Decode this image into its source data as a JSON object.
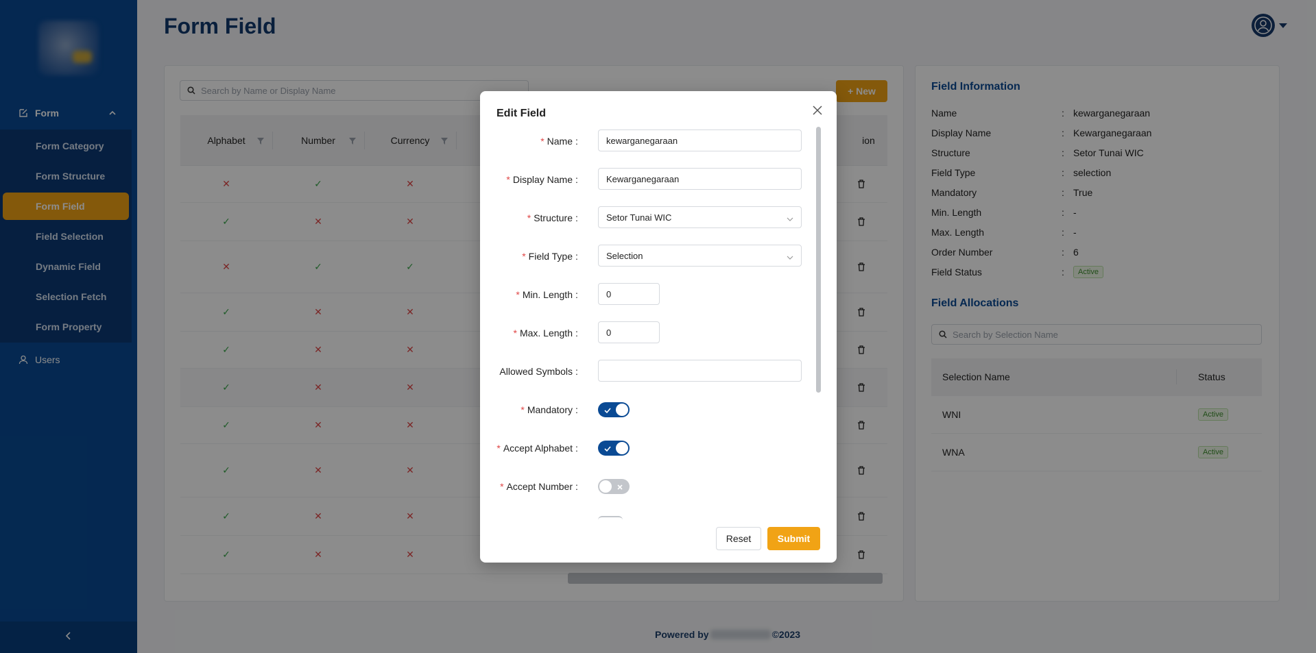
{
  "sidebar": {
    "parent_label": "Form",
    "items": [
      {
        "label": "Form Category",
        "active": false
      },
      {
        "label": "Form Structure",
        "active": false
      },
      {
        "label": "Form Field",
        "active": true
      },
      {
        "label": "Field Selection",
        "active": false
      },
      {
        "label": "Dynamic Field",
        "active": false
      },
      {
        "label": "Selection Fetch",
        "active": false
      },
      {
        "label": "Form Property",
        "active": false
      }
    ],
    "users_label": "Users"
  },
  "header": {
    "title": "Form Field"
  },
  "list": {
    "search_placeholder": "Search by Name or Display Name",
    "new_button": "+ New",
    "columns": [
      "Alphabet",
      "Number",
      "Currency",
      "ion"
    ],
    "rows": [
      {
        "alphabet": "✕",
        "number": "✓",
        "currency": "✕"
      },
      {
        "alphabet": "✓",
        "number": "✕",
        "currency": "✕"
      },
      {
        "alphabet": "✕",
        "number": "✓",
        "currency": "✓"
      },
      {
        "alphabet": "✓",
        "number": "✕",
        "currency": "✕"
      },
      {
        "alphabet": "✓",
        "number": "✕",
        "currency": "✕"
      },
      {
        "alphabet": "✓",
        "number": "✕",
        "currency": "✕"
      },
      {
        "alphabet": "✓",
        "number": "✕",
        "currency": "✕"
      },
      {
        "alphabet": "✓",
        "number": "✕",
        "currency": "✕"
      },
      {
        "alphabet": "✓",
        "number": "✕",
        "currency": "✕"
      },
      {
        "alphabet": "✓",
        "number": "✕",
        "currency": "✕"
      }
    ]
  },
  "field_info": {
    "title": "Field Information",
    "rows": [
      {
        "key": "Name",
        "value": "kewarganegaraan"
      },
      {
        "key": "Display Name",
        "value": "Kewarganegaraan"
      },
      {
        "key": "Structure",
        "value": "Setor Tunai WIC"
      },
      {
        "key": "Field Type",
        "value": "selection"
      },
      {
        "key": "Mandatory",
        "value": "True"
      },
      {
        "key": "Min. Length",
        "value": "-"
      },
      {
        "key": "Max. Length",
        "value": "-"
      },
      {
        "key": "Order Number",
        "value": "6"
      },
      {
        "key": "Field Status",
        "value": "Active"
      }
    ],
    "colon": ":"
  },
  "allocations": {
    "title": "Field Allocations",
    "search_placeholder": "Search by Selection Name",
    "col_name": "Selection Name",
    "col_status": "Status",
    "rows": [
      {
        "name": "WNI",
        "status": "Active"
      },
      {
        "name": "WNA",
        "status": "Active"
      }
    ]
  },
  "footer": {
    "prefix": "Powered by",
    "suffix": "©2023"
  },
  "modal": {
    "title": "Edit Field",
    "fields": {
      "name": {
        "label": "Name",
        "value": "kewarganegaraan"
      },
      "display_name": {
        "label": "Display Name",
        "value": "Kewarganegaraan"
      },
      "structure": {
        "label": "Structure",
        "value": "Setor Tunai WIC"
      },
      "field_type": {
        "label": "Field Type",
        "value": "Selection"
      },
      "min_length": {
        "label": "Min. Length",
        "value": "0"
      },
      "max_length": {
        "label": "Max. Length",
        "value": "0"
      },
      "allowed_symbols": {
        "label": "Allowed Symbols",
        "value": ""
      },
      "mandatory": {
        "label": "Mandatory",
        "on": true
      },
      "accept_alphabet": {
        "label": "Accept Alphabet",
        "on": true
      },
      "accept_number": {
        "label": "Accept Number",
        "on": false
      }
    },
    "required_mark": "*",
    "colon": ":",
    "reset_label": "Reset",
    "submit_label": "Submit"
  },
  "colors": {
    "primary": "#0a4a94",
    "accent": "#f1a315",
    "ok": "#3aa64a",
    "no": "#e04646"
  }
}
